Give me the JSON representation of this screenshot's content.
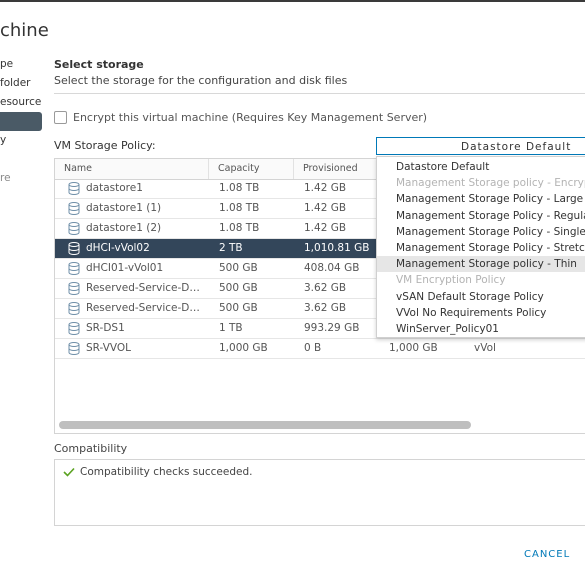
{
  "window": {
    "title": "chine"
  },
  "nav": {
    "items": [
      {
        "label": "pe"
      },
      {
        "label": "folder"
      },
      {
        "label": "esource"
      },
      {
        "label": ""
      },
      {
        "label": "y"
      },
      {
        "label": ""
      },
      {
        "label": "re"
      }
    ]
  },
  "section": {
    "title": "Select storage",
    "subtitle": "Select the storage for the configuration and disk files"
  },
  "encrypt": {
    "label": "Encrypt this virtual machine (Requires Key Management Server)"
  },
  "policy": {
    "label": "VM Storage Policy:",
    "selected": "Datastore Default"
  },
  "table": {
    "columns": [
      "Name",
      "Capacity",
      "Provisioned"
    ],
    "rows": [
      {
        "name": "datastore1",
        "capacity": "1.08 TB",
        "provisioned": "1.42 GB",
        "selected": false
      },
      {
        "name": "datastore1 (1)",
        "capacity": "1.08 TB",
        "provisioned": "1.42 GB",
        "selected": false
      },
      {
        "name": "datastore1 (2)",
        "capacity": "1.08 TB",
        "provisioned": "1.42 GB",
        "selected": false
      },
      {
        "name": "dHCI-vVol02",
        "capacity": "2 TB",
        "provisioned": "1,010.81 GB",
        "selected": true
      },
      {
        "name": "dHCI01-vVol01",
        "capacity": "500 GB",
        "provisioned": "408.04 GB",
        "selected": false
      },
      {
        "name": "Reserved-Service-Datast...",
        "capacity": "500 GB",
        "provisioned": "3.62 GB",
        "selected": false
      },
      {
        "name": "Reserved-Service-Datast...",
        "capacity": "500 GB",
        "provisioned": "3.62 GB",
        "selected": false
      },
      {
        "name": "SR-DS1",
        "capacity": "1 TB",
        "provisioned": "993.29 GB",
        "selected": false
      },
      {
        "name": "SR-VVOL",
        "capacity": "1,000 GB",
        "provisioned": "0 B",
        "free": "1,000 GB",
        "type": "vVol",
        "selected": false
      }
    ]
  },
  "dropdown": {
    "options": [
      {
        "label": "Datastore Default",
        "state": "normal"
      },
      {
        "label": "Management Storage policy - Encryption",
        "state": "disabled"
      },
      {
        "label": "Management Storage Policy - Large",
        "state": "normal"
      },
      {
        "label": "Management Storage Policy - Regular",
        "state": "normal"
      },
      {
        "label": "Management Storage Policy - Single Node",
        "state": "normal"
      },
      {
        "label": "Management Storage Policy - Stretched",
        "state": "normal"
      },
      {
        "label": "Management Storage policy - Thin",
        "state": "hover"
      },
      {
        "label": "VM Encryption Policy",
        "state": "disabled"
      },
      {
        "label": "vSAN Default Storage Policy",
        "state": "normal"
      },
      {
        "label": "VVol No Requirements Policy",
        "state": "normal"
      },
      {
        "label": "WinServer_Policy01",
        "state": "normal"
      }
    ]
  },
  "compatibility": {
    "label": "Compatibility",
    "message": "Compatibility checks succeeded."
  },
  "footer": {
    "cancel_label": "CANCEL"
  },
  "colors": {
    "accent": "#0079b8",
    "selected_row": "#33465a",
    "success": "#5aa220"
  }
}
